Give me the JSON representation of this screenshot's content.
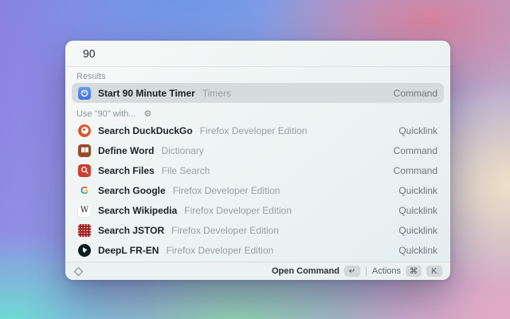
{
  "search": {
    "value": "90"
  },
  "sections": [
    {
      "label": "Results",
      "items": [
        {
          "icon": "timer-icon",
          "title": "Start 90 Minute Timer",
          "subtitle": "Timers",
          "accessory": "Command",
          "selected": true
        }
      ]
    },
    {
      "label": "Use \"90\" with...",
      "gear": true,
      "items": [
        {
          "icon": "duckduckgo-icon",
          "title": "Search DuckDuckGo",
          "subtitle": "Firefox Developer Edition",
          "accessory": "Quicklink"
        },
        {
          "icon": "dictionary-icon",
          "title": "Define Word",
          "subtitle": "Dictionary",
          "accessory": "Command"
        },
        {
          "icon": "file-search-icon",
          "title": "Search Files",
          "subtitle": "File Search",
          "accessory": "Command"
        },
        {
          "icon": "google-icon",
          "title": "Search Google",
          "subtitle": "Firefox Developer Edition",
          "accessory": "Quicklink"
        },
        {
          "icon": "wikipedia-icon",
          "title": "Search Wikipedia",
          "subtitle": "Firefox Developer Edition",
          "accessory": "Quicklink"
        },
        {
          "icon": "jstor-icon",
          "title": "Search JSTOR",
          "subtitle": "Firefox Developer Edition",
          "accessory": "Quicklink"
        },
        {
          "icon": "deepl-icon",
          "title": "DeepL FR-EN",
          "subtitle": "Firefox Developer Edition",
          "accessory": "Quicklink"
        }
      ]
    }
  ],
  "footer": {
    "primary_label": "Open Command",
    "primary_key": "↵",
    "secondary_label": "Actions",
    "secondary_keys": [
      "⌘",
      "K"
    ]
  },
  "colors": {
    "selected_row": "#d6dcdc",
    "panel": "#ecf3f2",
    "timer_blue": "#3f6fe8",
    "duckduckgo_red": "#de5833",
    "dictionary_brown": "#9a4a2c",
    "file_search_red": "#d23b30",
    "jstor_crimson": "#9e1f1f",
    "deepl_black": "#101a22"
  }
}
